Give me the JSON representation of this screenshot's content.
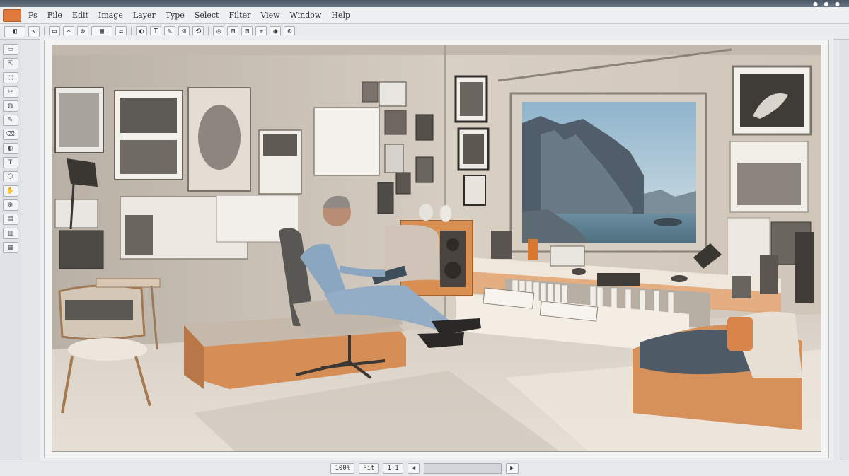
{
  "window": {
    "title_dots": "● ● ●"
  },
  "menubar": {
    "app_badge": "",
    "items": [
      "Ps",
      "File",
      "Edit",
      "Image",
      "Layer",
      "Type",
      "Select",
      "Filter",
      "View",
      "Window",
      "Help"
    ]
  },
  "toolbar": {
    "buttons": [
      "◧",
      "↖",
      "▭",
      "✂",
      "⊕",
      "▦",
      "⇄",
      "◐",
      "T",
      "✎",
      "⌫",
      "⟲",
      "◎",
      "⊞",
      "⊟",
      "⌖",
      "◉",
      "⚙"
    ]
  },
  "left_panel": {
    "tools": [
      "▭",
      "⇱",
      "⬚",
      "✂",
      "◍",
      "✎",
      "⌫",
      "◐",
      "T",
      "⬡",
      "✋",
      "⊕",
      "▤",
      "▥",
      "▦"
    ]
  },
  "statusbar": {
    "buttons": [
      "100%",
      "Fit",
      "1:1",
      "◀",
      "▶"
    ],
    "field": ""
  },
  "colors": {
    "accent": "#e07a3c",
    "chrome": "#e4e6e9",
    "titlebar": "#4a5866"
  },
  "icons": {
    "app": "photo-editor-icon",
    "close": "close-icon"
  }
}
